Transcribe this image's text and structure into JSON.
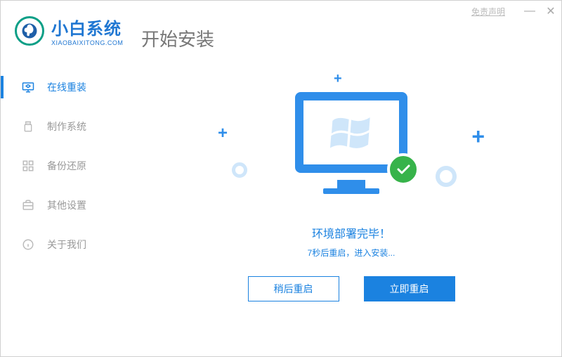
{
  "titlebar": {
    "disclaimer": "免责声明"
  },
  "brand": {
    "title": "小白系统",
    "sub": "XIAOBAIXITONG.COM"
  },
  "main_title": "开始安装",
  "sidebar": {
    "items": [
      {
        "label": "在线重装"
      },
      {
        "label": "制作系统"
      },
      {
        "label": "备份还原"
      },
      {
        "label": "其他设置"
      },
      {
        "label": "关于我们"
      }
    ]
  },
  "status": {
    "title": "环境部署完毕！",
    "sub": "7秒后重启，进入安装..."
  },
  "buttons": {
    "later": "稍后重启",
    "now": "立即重启"
  },
  "icons": {
    "minus": "—",
    "close": "✕",
    "check": "✓"
  }
}
